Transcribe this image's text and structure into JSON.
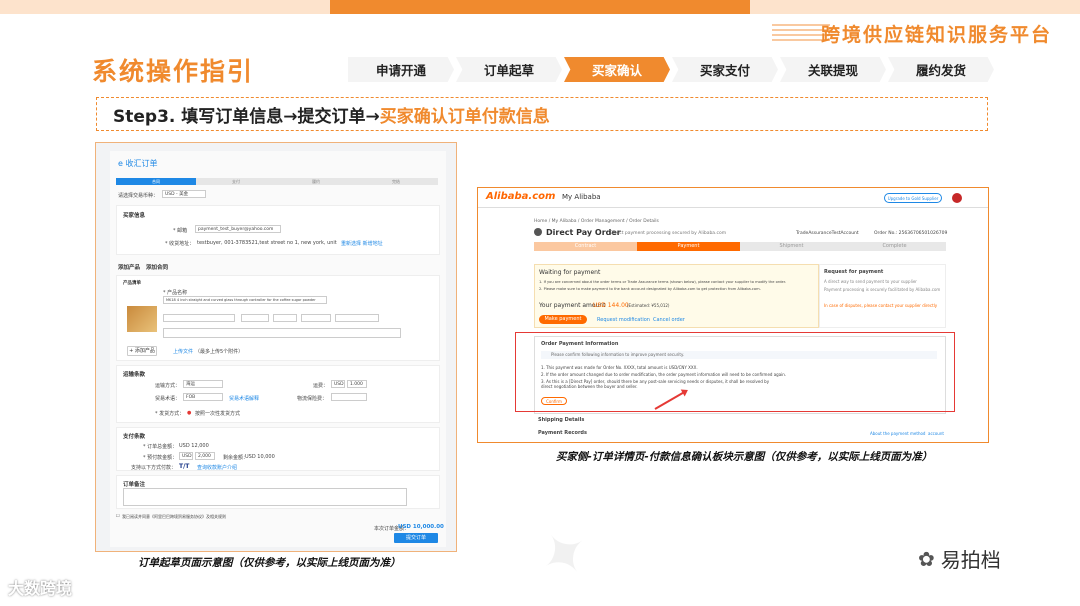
{
  "header": {
    "platform_title": "跨境供应链知识服务平台",
    "page_title": "系统操作指引"
  },
  "steps": [
    {
      "label": "申请开通",
      "active": false
    },
    {
      "label": "订单起草",
      "active": false
    },
    {
      "label": "买家确认",
      "active": true
    },
    {
      "label": "买家支付",
      "active": false
    },
    {
      "label": "关联提现",
      "active": false
    },
    {
      "label": "履约发货",
      "active": false
    }
  ],
  "step_line": {
    "prefix": "Step3. 填写订单信息→提交订单→",
    "highlight": "买家确认订单付款信息"
  },
  "left_panel": {
    "title": "e 收汇订单",
    "progress": [
      "合同",
      "支付",
      "履约",
      "完结"
    ],
    "currency_label": "请选择交易币种：",
    "currency_value": "USD - 美金",
    "buyer_section": "买家信息",
    "email_label": "* 邮箱",
    "email_value": "payment_test_buyer@yahoo.com",
    "address_label": "* 收货地址：",
    "address_value": "testbuyer, 001-3783521,test street no 1, new york, united states",
    "address_links": "重新选择 新增地址",
    "tabs": [
      "添加产品",
      "添加合同"
    ],
    "product_section": "产品清单",
    "product_name_label": "* 产品名称",
    "product_name_value": "MK18 4 inch straight and curved glass through controller for the coffee sugar powder",
    "add_product_button": "+ 添加产品",
    "upload_link": "上传文件",
    "upload_hint": "（最多上传5个附件）",
    "shipping_section": "运输条款",
    "ship_method_label": "运输方式：",
    "ship_method_value": "海运",
    "freight_label": "运费：",
    "freight_value": "USD",
    "freight_amount": "1.000",
    "trade_terms_label": "贸易术语：",
    "trade_terms_value": "FOB",
    "trade_terms_link": "贸易术语解释",
    "ship_date_label": "物流保险费：",
    "shipment_label": "* 发货方式：",
    "shipment_value": "按照一次性发货方式",
    "payment_section": "支付条款",
    "total_label": "* 订单总金额：",
    "total_value": "USD 12,000",
    "prepay_label": "* 预付款金额：",
    "prepay_currency": "USD",
    "prepay_amount": "2,000",
    "balance_label": "剩余金额：",
    "balance_value": "USD 10,000",
    "collection_label": "支持以下方式付款：",
    "collection_value": "T/T",
    "collection_link": "查询收款账户介绍",
    "remark_section": "订单备注",
    "agree_text": "我已阅读并同意《阿里巴巴跨境贸易服务协议》及相关规则",
    "order_total_label": "本次订单金额：",
    "order_total_value": "USD 10,000.00",
    "submit_button": "提交订单",
    "caption": "订单起草页面示意图（仅供参考，以实际上线页面为准）"
  },
  "right_panel": {
    "logo": "Alibaba.com",
    "my_alibaba": "My Alibaba",
    "upgrade_button": "Upgrade to Gold Supplier",
    "breadcrumb": "Home  /  My Alibaba  /  Order Management  /  Order Details",
    "order_title": "Direct Pay Order",
    "order_subtitle": "Direct payment processing secured by Alibaba.com",
    "account": "TradeAssuranceTestAccount",
    "order_no": "Order No.: 25636706501026709",
    "progress": [
      "Contract",
      "Payment",
      "Shipment",
      "Complete"
    ],
    "waiting_title": "Waiting for payment",
    "waiting_line1": "1. If you are concerned about the order terms or Trade Assurance terms (shown below), please contact your supplier to modify the order.",
    "waiting_line2": "2. Please make sure to make payment to the bank account designated by Alibaba.com to get protection from Alibaba.com.",
    "amount_label": "Your payment amount",
    "amount_value": "USD 144.00",
    "estimated": "(Estimated: ¥55,012)",
    "make_payment_button": "Make payment",
    "request_link": "Request modification",
    "cancel_link": "Cancel order",
    "side_title": "Request for payment",
    "side_line1": "A direct way to send payment to your supplier",
    "side_line2": "Payment processing is securely facilitated by Alibaba.com",
    "side_line3": "In case of disputes, please contact your supplier directly",
    "opi_title": "Order Payment Information",
    "opi_notice": "Please confirm following information to improve payment security.",
    "opi_line1": "1. This payment was made for Order No. XXXX, total amount is USD/CNY XXX.",
    "opi_line2": "2. If the order amount changed due to order modification, the order payment information will need to be confirmed again.",
    "opi_line3": "3. As this is a [Direct Pay] order, should there be any post-sale servicing needs or disputes, it shall be resolved by direct negotiation between the buyer and seller.",
    "confirm_button": "Confirm",
    "shipping_details": "Shipping Details",
    "payment_records": "Payment Records",
    "about_link": "About the payment method",
    "account_link": "account",
    "caption": "买家侧-订单详情页-付款信息确认板块示意图（仅供参考，以实际上线页面为准）"
  },
  "brand": {
    "bottom_left": "大数跨境",
    "bottom_right": "易拍档"
  },
  "colors": {
    "accent": "#f08a2e",
    "link": "#1e88e5",
    "alert": "#e53935"
  }
}
